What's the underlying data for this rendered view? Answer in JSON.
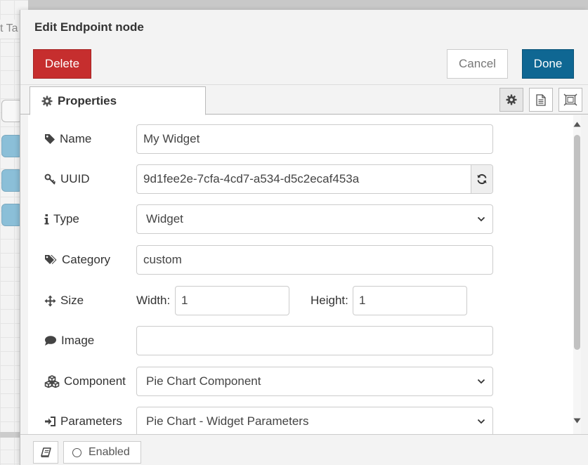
{
  "background": {
    "tab_fragment": "t Ta"
  },
  "dialog": {
    "title": "Edit Endpoint node",
    "buttons": {
      "delete": "Delete",
      "cancel": "Cancel",
      "done": "Done"
    },
    "tabs": {
      "properties": "Properties"
    },
    "form": {
      "name": {
        "label": "Name",
        "value": "My Widget"
      },
      "uuid": {
        "label": "UUID",
        "value": "9d1fee2e-7cfa-4cd7-a534-d5c2ecaf453a"
      },
      "type": {
        "label": "Type",
        "value": "Widget"
      },
      "category": {
        "label": "Category",
        "value": "custom"
      },
      "size": {
        "label": "Size",
        "width_label": "Width:",
        "width_value": "1",
        "height_label": "Height:",
        "height_value": "1"
      },
      "image": {
        "label": "Image",
        "value": ""
      },
      "component": {
        "label": "Component",
        "value": "Pie Chart Component"
      },
      "parameters": {
        "label": "Parameters",
        "value": "Pie Chart - Widget Parameters"
      }
    },
    "footer": {
      "enabled_label": "Enabled"
    }
  },
  "colors": {
    "delete": "#c62e2e",
    "done": "#0f6793"
  }
}
